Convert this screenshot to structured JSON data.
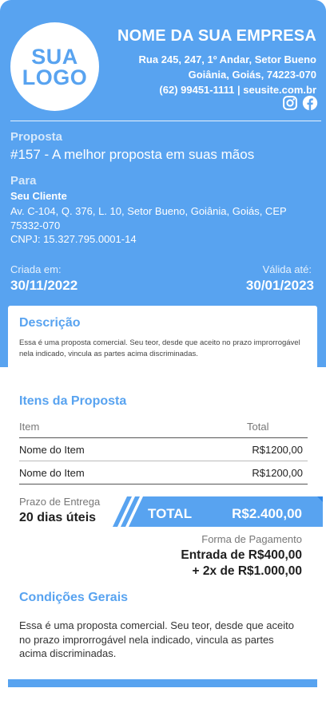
{
  "colors": {
    "accent": "#58a3f0",
    "dark_accent": "#2e86e6",
    "text": "#1f1f1f"
  },
  "logo": {
    "line1": "SUA",
    "line2": "LOGO"
  },
  "company": {
    "name": "NOME DA SUA EMPRESA",
    "address_line1": "Rua 245, 247, 1º Andar, Setor Bueno",
    "address_line2": "Goiânia, Goiás, 74223-070",
    "contact": "(62) 99451-1111 | seusite.com.br"
  },
  "social": {
    "icons": [
      "instagram-icon",
      "facebook-icon"
    ]
  },
  "proposal": {
    "label": "Proposta",
    "title": "#157 - A melhor proposta em suas mãos"
  },
  "client": {
    "label": "Para",
    "name": "Seu Cliente",
    "address": "Av. C-104, Q. 376, L. 10, Setor Bueno, Goiânia, Goiás, CEP 75332-070",
    "cnpj": "CNPJ: 15.327.795.0001-14"
  },
  "dates": {
    "created_label": "Criada em:",
    "created_value": "30/11/2022",
    "valid_label": "Válida até:",
    "valid_value": "30/01/2023"
  },
  "description": {
    "title": "Descrição",
    "text": "Essa é uma proposta comercial. Seu teor, desde que aceito no prazo improrrogável nela indicado, vincula as partes acima discriminadas."
  },
  "items": {
    "title": "Itens da Proposta",
    "headers": {
      "item": "Item",
      "total": "Total"
    },
    "rows": [
      {
        "item": "Nome do Item",
        "total": "R$1200,00"
      },
      {
        "item": "Nome do Item",
        "total": "R$1200,00"
      }
    ]
  },
  "delivery": {
    "label": "Prazo de Entrega",
    "value": "20 dias úteis"
  },
  "total": {
    "label": "TOTAL",
    "value": "R$2.400,00"
  },
  "payment": {
    "label": "Forma de Pagamento",
    "line1": "Entrada de R$400,00",
    "line2": "+ 2x de R$1.000,00"
  },
  "conditions": {
    "title": "Condições Gerais",
    "text": "Essa é uma proposta comercial. Seu teor, desde que aceito no prazo improrrogável nela indicado, vincula as partes acima discriminadas."
  }
}
